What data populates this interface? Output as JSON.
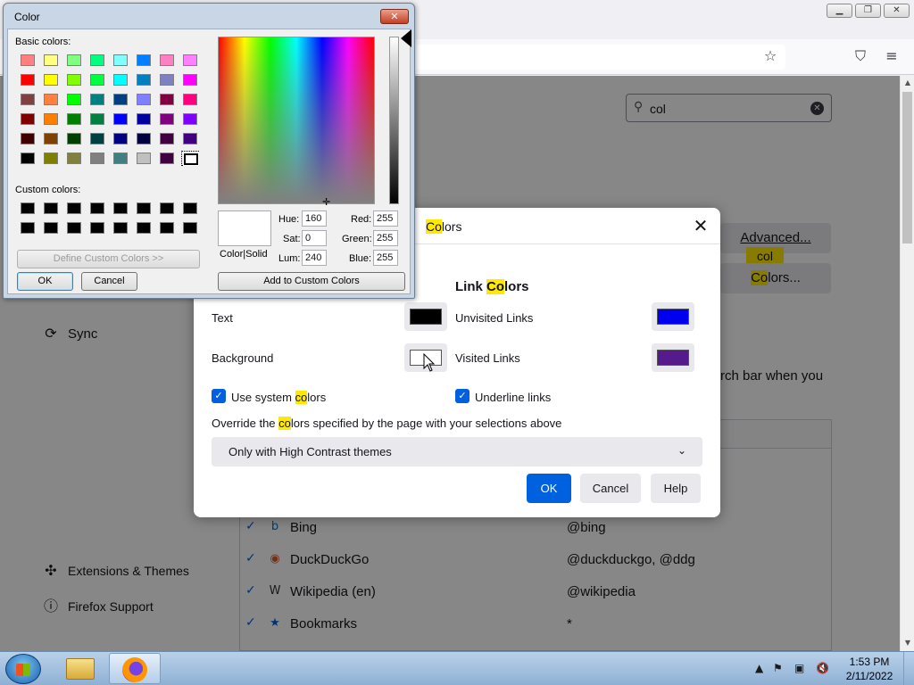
{
  "browser": {
    "settings_search": {
      "value": "col"
    },
    "sidebar": {
      "sync": "Sync",
      "extensions": "Extensions & Themes",
      "support": "Firefox Support"
    },
    "advanced_button": "Advanced...",
    "colors_button_pre": "",
    "colors_button_hl": "Co",
    "colors_button_post": "lors...",
    "search_tooltip": "col",
    "hint_text": "rch bar when you",
    "engines": [
      {
        "name": "Bing",
        "keyword": "@bing",
        "icon": "bing-icon"
      },
      {
        "name": "DuckDuckGo",
        "keyword": "@duckduckgo, @ddg",
        "icon": "duckduckgo-icon"
      },
      {
        "name": "Wikipedia (en)",
        "keyword": "@wikipedia",
        "icon": "wikipedia-icon"
      },
      {
        "name": "Bookmarks",
        "keyword": "*",
        "icon": "star-icon"
      }
    ]
  },
  "colors_dialog": {
    "title_hl": "Co",
    "title_rest": "lors",
    "link_heading_pre": "Link ",
    "link_heading_hl": "Co",
    "link_heading_post": "lors",
    "text_label": "Text",
    "background_label": "Background",
    "unvisited_label": "Unvisited Links",
    "visited_label": "Visited Links",
    "use_system_pre": "Use system ",
    "use_system_hl": "co",
    "use_system_post": "lors",
    "underline_label": "Underline links",
    "override_pre": "Override the ",
    "override_hl": "co",
    "override_post": "lors specified by the page with your selections above",
    "override_value": "Only with High Contrast themes",
    "ok": "OK",
    "cancel": "Cancel",
    "help": "Help",
    "colors": {
      "text": "#000000",
      "background": "#ffffff",
      "unvisited": "#0000ee",
      "visited": "#551a8b"
    }
  },
  "color_picker": {
    "title": "Color",
    "basic_label": "Basic colors:",
    "custom_label": "Custom colors:",
    "define_custom": "Define Custom Colors >>",
    "ok": "OK",
    "cancel": "Cancel",
    "color_solid": "Color|Solid",
    "hue_label": "Hue:",
    "hue": "160",
    "sat_label": "Sat:",
    "sat": "0",
    "lum_label": "Lum:",
    "lum": "240",
    "red_label": "Red:",
    "red": "255",
    "green_label": "Green:",
    "green": "255",
    "blue_label": "Blue:",
    "blue": "255",
    "add_custom": "Add to Custom Colors",
    "basic_colors": [
      "#ff8080",
      "#ffff80",
      "#80ff80",
      "#00ff80",
      "#80ffff",
      "#0080ff",
      "#ff80c0",
      "#ff80ff",
      "#ff0000",
      "#ffff00",
      "#80ff00",
      "#00ff40",
      "#00ffff",
      "#0080c0",
      "#8080c0",
      "#ff00ff",
      "#804040",
      "#ff8040",
      "#00ff00",
      "#008080",
      "#004080",
      "#8080ff",
      "#800040",
      "#ff0080",
      "#800000",
      "#ff8000",
      "#008000",
      "#008040",
      "#0000ff",
      "#0000a0",
      "#800080",
      "#8000ff",
      "#400000",
      "#804000",
      "#004000",
      "#004040",
      "#000080",
      "#000040",
      "#400040",
      "#400080",
      "#000000",
      "#808000",
      "#808040",
      "#808080",
      "#408080",
      "#c0c0c0",
      "#400040",
      "#ffffff"
    ],
    "selected_index": 47
  },
  "taskbar": {
    "time": "1:53 PM",
    "date": "2/11/2022"
  }
}
